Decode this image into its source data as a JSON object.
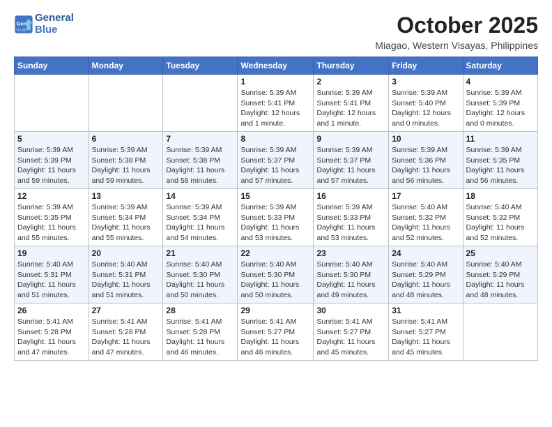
{
  "header": {
    "logo_line1": "General",
    "logo_line2": "Blue",
    "month": "October 2025",
    "location": "Miagao, Western Visayas, Philippines"
  },
  "weekdays": [
    "Sunday",
    "Monday",
    "Tuesday",
    "Wednesday",
    "Thursday",
    "Friday",
    "Saturday"
  ],
  "weeks": [
    [
      {
        "day": "",
        "detail": ""
      },
      {
        "day": "",
        "detail": ""
      },
      {
        "day": "",
        "detail": ""
      },
      {
        "day": "1",
        "detail": "Sunrise: 5:39 AM\nSunset: 5:41 PM\nDaylight: 12 hours\nand 1 minute."
      },
      {
        "day": "2",
        "detail": "Sunrise: 5:39 AM\nSunset: 5:41 PM\nDaylight: 12 hours\nand 1 minute."
      },
      {
        "day": "3",
        "detail": "Sunrise: 5:39 AM\nSunset: 5:40 PM\nDaylight: 12 hours\nand 0 minutes."
      },
      {
        "day": "4",
        "detail": "Sunrise: 5:39 AM\nSunset: 5:39 PM\nDaylight: 12 hours\nand 0 minutes."
      }
    ],
    [
      {
        "day": "5",
        "detail": "Sunrise: 5:39 AM\nSunset: 5:39 PM\nDaylight: 11 hours\nand 59 minutes."
      },
      {
        "day": "6",
        "detail": "Sunrise: 5:39 AM\nSunset: 5:38 PM\nDaylight: 11 hours\nand 59 minutes."
      },
      {
        "day": "7",
        "detail": "Sunrise: 5:39 AM\nSunset: 5:38 PM\nDaylight: 11 hours\nand 58 minutes."
      },
      {
        "day": "8",
        "detail": "Sunrise: 5:39 AM\nSunset: 5:37 PM\nDaylight: 11 hours\nand 57 minutes."
      },
      {
        "day": "9",
        "detail": "Sunrise: 5:39 AM\nSunset: 5:37 PM\nDaylight: 11 hours\nand 57 minutes."
      },
      {
        "day": "10",
        "detail": "Sunrise: 5:39 AM\nSunset: 5:36 PM\nDaylight: 11 hours\nand 56 minutes."
      },
      {
        "day": "11",
        "detail": "Sunrise: 5:39 AM\nSunset: 5:35 PM\nDaylight: 11 hours\nand 56 minutes."
      }
    ],
    [
      {
        "day": "12",
        "detail": "Sunrise: 5:39 AM\nSunset: 5:35 PM\nDaylight: 11 hours\nand 55 minutes."
      },
      {
        "day": "13",
        "detail": "Sunrise: 5:39 AM\nSunset: 5:34 PM\nDaylight: 11 hours\nand 55 minutes."
      },
      {
        "day": "14",
        "detail": "Sunrise: 5:39 AM\nSunset: 5:34 PM\nDaylight: 11 hours\nand 54 minutes."
      },
      {
        "day": "15",
        "detail": "Sunrise: 5:39 AM\nSunset: 5:33 PM\nDaylight: 11 hours\nand 53 minutes."
      },
      {
        "day": "16",
        "detail": "Sunrise: 5:39 AM\nSunset: 5:33 PM\nDaylight: 11 hours\nand 53 minutes."
      },
      {
        "day": "17",
        "detail": "Sunrise: 5:40 AM\nSunset: 5:32 PM\nDaylight: 11 hours\nand 52 minutes."
      },
      {
        "day": "18",
        "detail": "Sunrise: 5:40 AM\nSunset: 5:32 PM\nDaylight: 11 hours\nand 52 minutes."
      }
    ],
    [
      {
        "day": "19",
        "detail": "Sunrise: 5:40 AM\nSunset: 5:31 PM\nDaylight: 11 hours\nand 51 minutes."
      },
      {
        "day": "20",
        "detail": "Sunrise: 5:40 AM\nSunset: 5:31 PM\nDaylight: 11 hours\nand 51 minutes."
      },
      {
        "day": "21",
        "detail": "Sunrise: 5:40 AM\nSunset: 5:30 PM\nDaylight: 11 hours\nand 50 minutes."
      },
      {
        "day": "22",
        "detail": "Sunrise: 5:40 AM\nSunset: 5:30 PM\nDaylight: 11 hours\nand 50 minutes."
      },
      {
        "day": "23",
        "detail": "Sunrise: 5:40 AM\nSunset: 5:30 PM\nDaylight: 11 hours\nand 49 minutes."
      },
      {
        "day": "24",
        "detail": "Sunrise: 5:40 AM\nSunset: 5:29 PM\nDaylight: 11 hours\nand 48 minutes."
      },
      {
        "day": "25",
        "detail": "Sunrise: 5:40 AM\nSunset: 5:29 PM\nDaylight: 11 hours\nand 48 minutes."
      }
    ],
    [
      {
        "day": "26",
        "detail": "Sunrise: 5:41 AM\nSunset: 5:28 PM\nDaylight: 11 hours\nand 47 minutes."
      },
      {
        "day": "27",
        "detail": "Sunrise: 5:41 AM\nSunset: 5:28 PM\nDaylight: 11 hours\nand 47 minutes."
      },
      {
        "day": "28",
        "detail": "Sunrise: 5:41 AM\nSunset: 5:28 PM\nDaylight: 11 hours\nand 46 minutes."
      },
      {
        "day": "29",
        "detail": "Sunrise: 5:41 AM\nSunset: 5:27 PM\nDaylight: 11 hours\nand 46 minutes."
      },
      {
        "day": "30",
        "detail": "Sunrise: 5:41 AM\nSunset: 5:27 PM\nDaylight: 11 hours\nand 45 minutes."
      },
      {
        "day": "31",
        "detail": "Sunrise: 5:41 AM\nSunset: 5:27 PM\nDaylight: 11 hours\nand 45 minutes."
      },
      {
        "day": "",
        "detail": ""
      }
    ]
  ]
}
